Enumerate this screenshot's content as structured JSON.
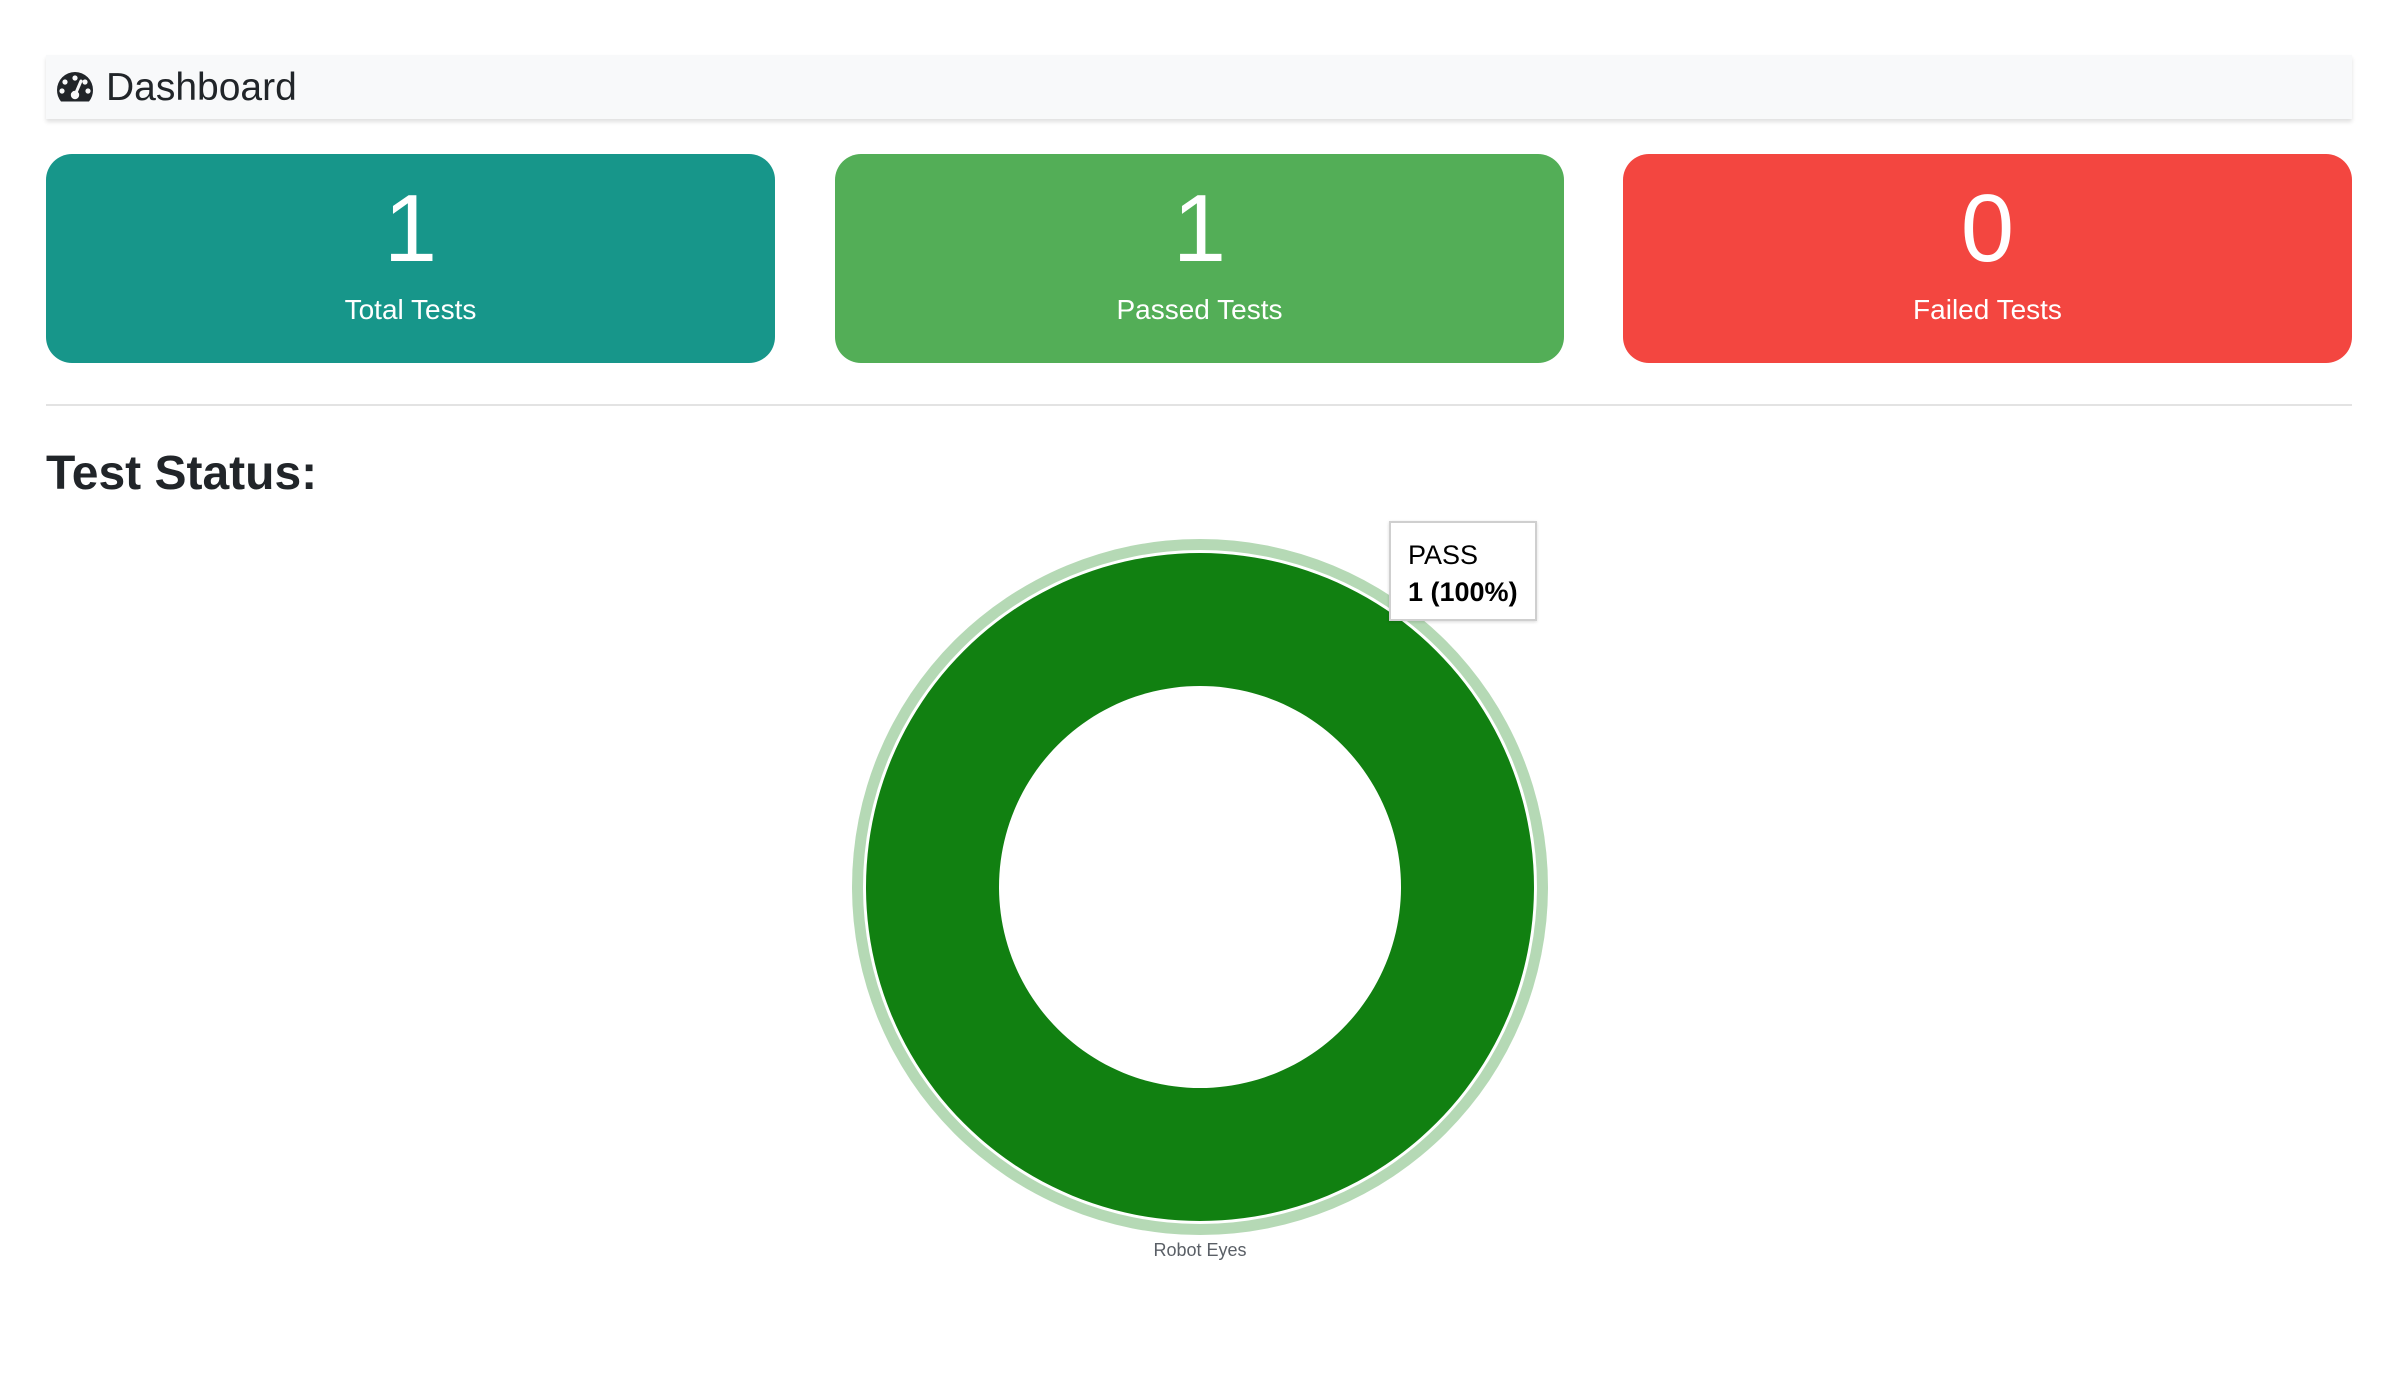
{
  "header": {
    "title": "Dashboard",
    "icon": "tachometer-icon"
  },
  "cards": [
    {
      "value": "1",
      "label": "Total Tests",
      "color": "#17968a"
    },
    {
      "value": "1",
      "label": "Passed Tests",
      "color": "#53ae57"
    },
    {
      "value": "0",
      "label": "Failed Tests",
      "color": "#f34640"
    }
  ],
  "section": {
    "title": "Test Status:"
  },
  "chart_data": {
    "type": "pie",
    "series": [
      {
        "name": "Robot Eyes",
        "slices": [
          {
            "label": "PASS",
            "value": 1,
            "color": "#118011"
          }
        ]
      }
    ],
    "caption": "Robot Eyes",
    "tooltip": {
      "label": "PASS",
      "value": "1 (100%)"
    },
    "hover_halo_color": "#b5d9b5"
  }
}
